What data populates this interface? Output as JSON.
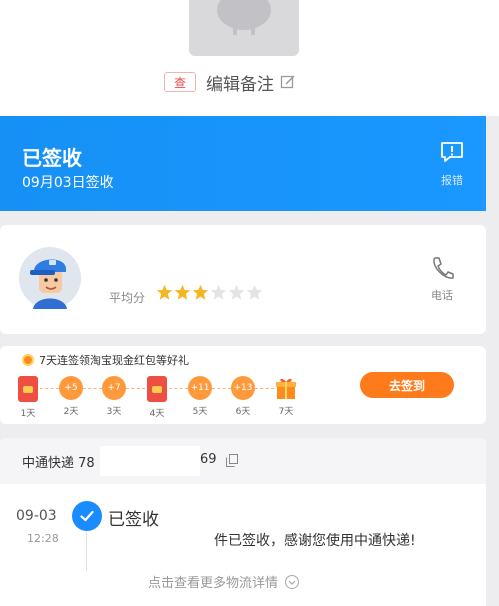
{
  "product": {
    "tag": "查",
    "edit_note_label": "编辑备注"
  },
  "banner": {
    "status_title": "已签收",
    "signed_date": "09月03日签收",
    "report_label": "报错",
    "color": "#1a90fa"
  },
  "courier": {
    "rating_label": "平均分",
    "rating": 3,
    "rating_max": 6,
    "phone_label": "电话"
  },
  "checkin": {
    "title": "7天连签领淘宝现金红包等好礼",
    "button_label": "去签到",
    "days": [
      {
        "badge": "",
        "kind": "red",
        "label": "1天"
      },
      {
        "badge": "+5",
        "kind": "coin",
        "label": "2天"
      },
      {
        "badge": "+7",
        "kind": "coin",
        "label": "3天"
      },
      {
        "badge": "",
        "kind": "red",
        "label": "4天"
      },
      {
        "badge": "+11",
        "kind": "coin",
        "label": "5天"
      },
      {
        "badge": "+13",
        "kind": "coin",
        "label": "6天"
      },
      {
        "badge": "",
        "kind": "gift",
        "label": "7天"
      }
    ]
  },
  "logistics": {
    "carrier": "中通快递 78",
    "tracking_tail": "69",
    "event": {
      "date": "09-03",
      "time": "12:28",
      "status": "已签收",
      "description": "件已签收，感谢您使用中通快递!"
    },
    "more_link": "点击查看更多物流详情"
  }
}
